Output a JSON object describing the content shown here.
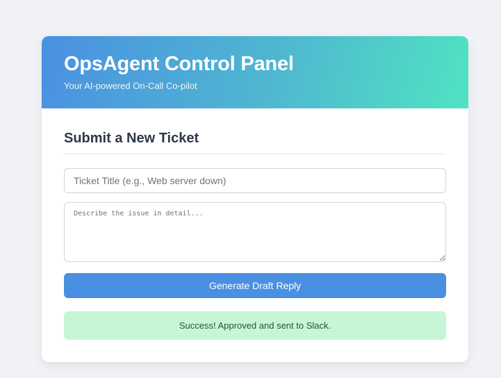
{
  "header": {
    "title": "OpsAgent Control Panel",
    "subtitle": "Your AI-powered On-Call Co-pilot",
    "gradient_start": "#4a90e2",
    "gradient_end": "#50e3c2"
  },
  "form": {
    "section_title": "Submit a New Ticket",
    "title_field": {
      "value": "",
      "placeholder": "Ticket Title (e.g., Web server down)"
    },
    "description_field": {
      "value": "",
      "placeholder": "Describe the issue in detail..."
    },
    "submit_label": "Generate Draft Reply",
    "submit_color": "#4a90e2"
  },
  "status": {
    "message": "Success! Approved and sent to Slack.",
    "type": "success",
    "background": "#c6f6d5"
  }
}
